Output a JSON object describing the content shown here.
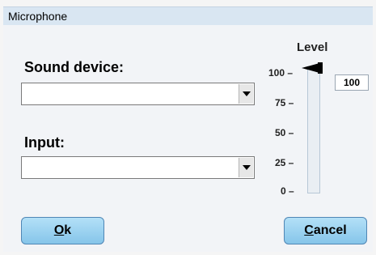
{
  "window": {
    "title": "Microphone"
  },
  "sound_device": {
    "label": "Sound device:",
    "value": ""
  },
  "input": {
    "label": "Input:",
    "value": ""
  },
  "level": {
    "title": "Level",
    "ticks": [
      "100 –",
      "75 –",
      "50 –",
      "25 –",
      "0 –"
    ],
    "value": "100",
    "fraction": 1.0
  },
  "buttons": {
    "ok": {
      "mnemonic": "O",
      "rest": "k"
    },
    "cancel": {
      "mnemonic": "C",
      "rest": "ancel"
    }
  }
}
